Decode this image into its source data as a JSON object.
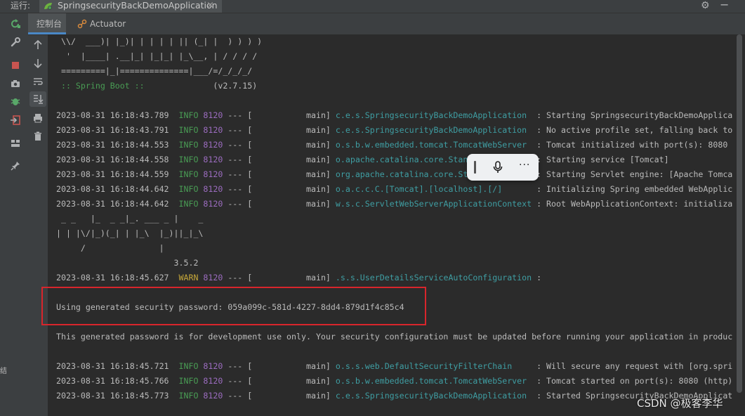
{
  "window": {
    "run_label": "运行:",
    "run_tab_title": "SpringsecurityBackDemoApplication"
  },
  "subtabs": {
    "console": "控制台",
    "actuator": "Actuator"
  },
  "banner": {
    "line1": " \\\\/  ___)| |_)| | | | | || (_| |  ) ) ) )",
    "line2": "  '  |____| .__|_| |_|_| |_\\__, | / / / /",
    "line3": " =========|_|==============|___/=/_/_/_/",
    "spring_boot_label": " :: Spring Boot :: ",
    "spring_boot_version": "             (v2.7.15)"
  },
  "logs": [
    {
      "ts": "2023-08-31 16:18:43.789",
      "level": "INFO",
      "pid": "8120",
      "sep": "--- [",
      "thread": "           main]",
      "logger": "c.e.s.SpringsecurityBackDemoApplication ",
      "msg": " : Starting SpringsecurityBackDemoApplica"
    },
    {
      "ts": "2023-08-31 16:18:43.791",
      "level": "INFO",
      "pid": "8120",
      "sep": "--- [",
      "thread": "           main]",
      "logger": "c.e.s.SpringsecurityBackDemoApplication ",
      "msg": " : No active profile set, falling back to"
    },
    {
      "ts": "2023-08-31 16:18:44.553",
      "level": "INFO",
      "pid": "8120",
      "sep": "--- [",
      "thread": "           main]",
      "logger": "o.s.b.w.embedded.tomcat.TomcatWebServer ",
      "msg": " : Tomcat initialized with port(s): 8080"
    },
    {
      "ts": "2023-08-31 16:18:44.558",
      "level": "INFO",
      "pid": "8120",
      "sep": "--- [",
      "thread": "           main]",
      "logger": "o.apache.catalina.core.StandardService  ",
      "msg": " : Starting service [Tomcat]"
    },
    {
      "ts": "2023-08-31 16:18:44.559",
      "level": "INFO",
      "pid": "8120",
      "sep": "--- [",
      "thread": "           main]",
      "logger": "org.apache.catalina.core.StandardEngine ",
      "msg": " : Starting Servlet engine: [Apache Tomca"
    },
    {
      "ts": "2023-08-31 16:18:44.642",
      "level": "INFO",
      "pid": "8120",
      "sep": "--- [",
      "thread": "           main]",
      "logger": "o.a.c.c.C.[Tomcat].[localhost].[/]      ",
      "msg": " : Initializing Spring embedded WebApplic"
    },
    {
      "ts": "2023-08-31 16:18:44.642",
      "level": "INFO",
      "pid": "8120",
      "sep": "--- [",
      "thread": "           main]",
      "logger": "w.s.c.ServletWebServerApplicationContext",
      "msg": " : Root WebApplicationContext: initializa"
    }
  ],
  "mp_banner": {
    "line1": " _ _   |_  _ _|_. ___ _ |    _",
    "line2": "| | |\\/|_)(_| | |_\\  |_)||_|_\\",
    "line3": "     /               |",
    "version": "                        3.5.2"
  },
  "warn_log": {
    "ts": "2023-08-31 16:18:45.627",
    "level": "WARN",
    "pid": "8120",
    "sep": "--- [",
    "thread": "           main]",
    "logger": ".s.s.UserDetailsServiceAutoConfiguration",
    "msg": " : "
  },
  "password_line": "Using generated security password: 059a099c-581d-4227-8dd4-879d1f4c85c4",
  "dev_note": "This generated password is for development use only. Your security configuration must be updated before running your application in produc",
  "logs2": [
    {
      "ts": "2023-08-31 16:18:45.721",
      "level": "INFO",
      "pid": "8120",
      "sep": "--- [",
      "thread": "           main]",
      "logger": "o.s.s.web.DefaultSecurityFilterChain    ",
      "msg": " : Will secure any request with [org.spri"
    },
    {
      "ts": "2023-08-31 16:18:45.766",
      "level": "INFO",
      "pid": "8120",
      "sep": "--- [",
      "thread": "           main]",
      "logger": "o.s.b.w.embedded.tomcat.TomcatWebServer ",
      "msg": " : Tomcat started on port(s): 8080 (http)"
    },
    {
      "ts": "2023-08-31 16:18:45.773",
      "level": "INFO",
      "pid": "8120",
      "sep": "--- [",
      "thread": "           main]",
      "logger": "c.e.s.SpringsecurityBackDemoApplication ",
      "msg": " : Started SpringsecurityBackDemoApplicat"
    }
  ],
  "watermark": "CSDN @极客李华",
  "left_vertical_text": "结",
  "colors": {
    "background": "#2b2b2b",
    "info": "#499c54",
    "warn": "#c7a83a",
    "pid": "#9b6cbf",
    "logger": "#3f9ea3",
    "highlight": "#d8252c"
  }
}
